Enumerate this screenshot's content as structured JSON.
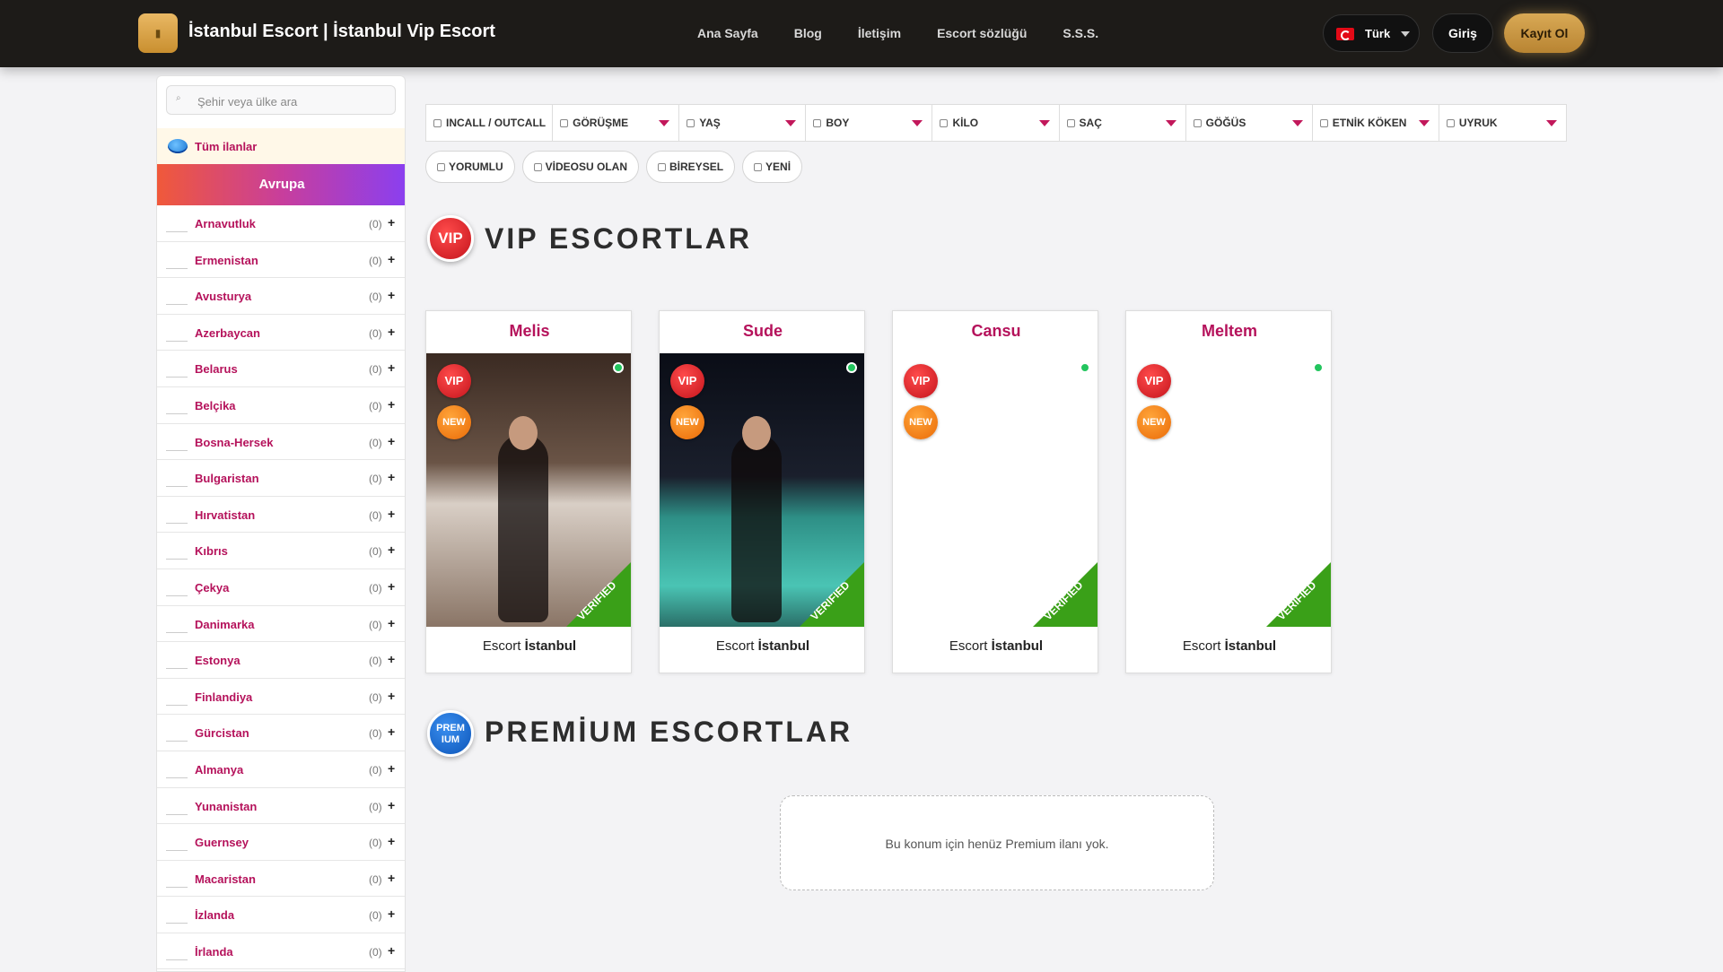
{
  "header": {
    "logo_icon": "menu-icon",
    "title": "İstanbul Escort | İstanbul Vip Escort",
    "nav": [
      "Ana Sayfa",
      "Blog",
      "İletişim",
      "Escort sözlüğü",
      "S.S.S."
    ],
    "language": "Türk",
    "login": "Giriş",
    "register": "Kayıt Ol"
  },
  "sidebar": {
    "search_placeholder": "Şehir veya ülke ara",
    "all_label": "Tüm ilanlar",
    "region": "Avrupa",
    "countries": [
      {
        "name": "Arnavutluk",
        "count": "(0)"
      },
      {
        "name": "Ermenistan",
        "count": "(0)"
      },
      {
        "name": "Avusturya",
        "count": "(0)"
      },
      {
        "name": "Azerbaycan",
        "count": "(0)"
      },
      {
        "name": "Belarus",
        "count": "(0)"
      },
      {
        "name": "Belçika",
        "count": "(0)"
      },
      {
        "name": "Bosna-Hersek",
        "count": "(0)"
      },
      {
        "name": "Bulgaristan",
        "count": "(0)"
      },
      {
        "name": "Hırvatistan",
        "count": "(0)"
      },
      {
        "name": "Kıbrıs",
        "count": "(0)"
      },
      {
        "name": "Çekya",
        "count": "(0)"
      },
      {
        "name": "Danimarka",
        "count": "(0)"
      },
      {
        "name": "Estonya",
        "count": "(0)"
      },
      {
        "name": "Finlandiya",
        "count": "(0)"
      },
      {
        "name": "Gürcistan",
        "count": "(0)"
      },
      {
        "name": "Almanya",
        "count": "(0)"
      },
      {
        "name": "Yunanistan",
        "count": "(0)"
      },
      {
        "name": "Guernsey",
        "count": "(0)"
      },
      {
        "name": "Macaristan",
        "count": "(0)"
      },
      {
        "name": "İzlanda",
        "count": "(0)"
      },
      {
        "name": "İrlanda",
        "count": "(0)"
      }
    ],
    "plus": "+"
  },
  "filters": [
    "INCALL / OUTCALL",
    "GÖRÜŞME",
    "YAŞ",
    "BOY",
    "KİLO",
    "SAÇ",
    "GÖĞÜS",
    "ETNİK KÖKEN",
    "UYRUK"
  ],
  "chips": [
    "YORUMLU",
    "VİDEOSU OLAN",
    "BİREYSEL",
    "YENİ"
  ],
  "vip_section": {
    "badge": "VIP",
    "title": "VIP ESCORTLAR",
    "cards": [
      {
        "name": "Melis",
        "foot_prefix": "Escort",
        "foot_city": "İstanbul",
        "online": true
      },
      {
        "name": "Sude",
        "foot_prefix": "Escort",
        "foot_city": "İstanbul",
        "online": true
      },
      {
        "name": "Cansu",
        "foot_prefix": "Escort",
        "foot_city": "İstanbul",
        "online": true
      },
      {
        "name": "Meltem",
        "foot_prefix": "Escort",
        "foot_city": "İstanbul",
        "online": true
      }
    ],
    "vip_label": "VIP",
    "new_label": "NEW",
    "verified_label": "VERIFIED"
  },
  "premium_section": {
    "badge": "PREM IUM",
    "title": "PREMİUM ESCORTLAR",
    "empty_text": "Bu konum için henüz Premium ilanı yok."
  },
  "colors": {
    "accent": "#b5125b",
    "gold": "#c98f2f",
    "online": "#22c55e",
    "verified": "#3aa018"
  }
}
